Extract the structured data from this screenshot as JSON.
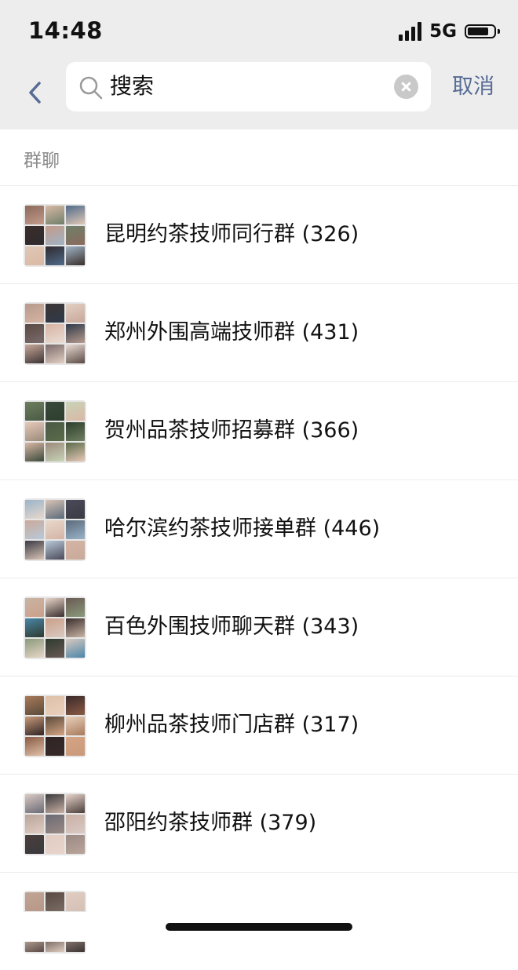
{
  "status_bar": {
    "time": "14:48",
    "network": "5G",
    "signal_bars": 4,
    "battery_level": 0.85
  },
  "search": {
    "back_icon": "chevron-left-icon",
    "query": "搜索",
    "clear_icon": "clear-circle-icon",
    "cancel_label": "取消"
  },
  "results": {
    "section_title": "群聊",
    "items": [
      {
        "title": "昆明约茶技师同行群 (326)"
      },
      {
        "title": "郑州外围高端技师群 (431)"
      },
      {
        "title": "贺州品茶技师招募群 (366)"
      },
      {
        "title": "哈尔滨约茶技师接单群 (446)"
      },
      {
        "title": "百色外围技师聊天群 (343)"
      },
      {
        "title": "柳州品茶技师门店群 (317)"
      },
      {
        "title": "邵阳约茶技师群 (379)"
      },
      {
        "title": ""
      }
    ]
  },
  "colors": {
    "header_bg": "#ededed",
    "accent": "#576b95",
    "section_text": "#8b8b8b"
  }
}
